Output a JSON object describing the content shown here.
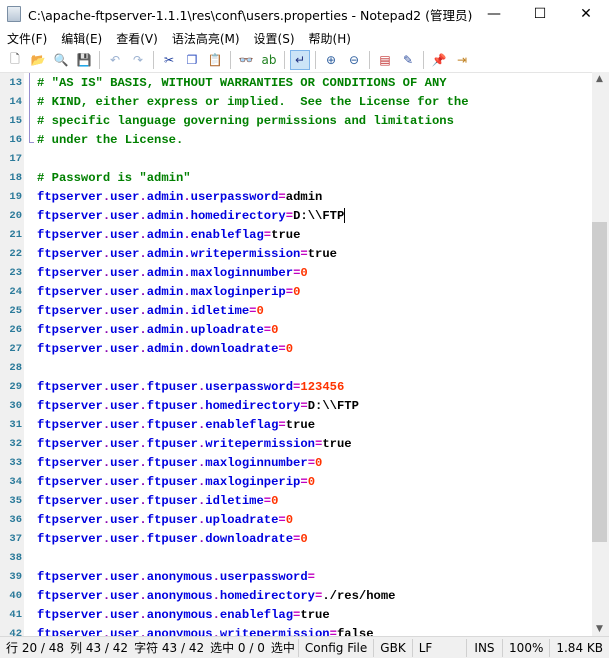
{
  "window": {
    "title": "C:\\apache-ftpserver-1.1.1\\res\\conf\\users.properties - Notepad2 (管理员)",
    "minimize": "—",
    "maximize": "☐",
    "close": "✕"
  },
  "menu": [
    "文件(F)",
    "编辑(E)",
    "查看(V)",
    "语法高亮(M)",
    "设置(S)",
    "帮助(H)"
  ],
  "toolbar": [
    {
      "icon": "new-file-icon",
      "glyph": "🗋",
      "color": "#555"
    },
    {
      "icon": "open-folder-icon",
      "glyph": "📂",
      "color": "#d9a020"
    },
    {
      "icon": "browse-icon",
      "glyph": "🔍",
      "color": "#c9a040"
    },
    {
      "icon": "save-icon",
      "glyph": "💾",
      "color": "#9aa0b8",
      "sep": true
    },
    {
      "icon": "undo-icon",
      "glyph": "↶",
      "color": "#9ab0d0"
    },
    {
      "icon": "redo-icon",
      "glyph": "↷",
      "color": "#9ab0d0",
      "sep": true
    },
    {
      "icon": "cut-icon",
      "glyph": "✂",
      "color": "#2040a0"
    },
    {
      "icon": "copy-icon",
      "glyph": "❐",
      "color": "#3050c0"
    },
    {
      "icon": "paste-icon",
      "glyph": "📋",
      "color": "#b08020",
      "sep": true
    },
    {
      "icon": "find-icon",
      "glyph": "👓",
      "color": "#203060"
    },
    {
      "icon": "replace-icon",
      "glyph": "ab",
      "color": "#208020",
      "sep": true
    },
    {
      "icon": "word-wrap-icon",
      "glyph": "↵",
      "color": "#203080",
      "active": true,
      "sep": true
    },
    {
      "icon": "zoom-in-icon",
      "glyph": "⊕",
      "color": "#3060a0"
    },
    {
      "icon": "zoom-out-icon",
      "glyph": "⊖",
      "color": "#3060a0",
      "sep": true
    },
    {
      "icon": "scheme-icon",
      "glyph": "▤",
      "color": "#c03030"
    },
    {
      "icon": "customize-scheme-icon",
      "glyph": "✎",
      "color": "#3050a0",
      "sep": true
    },
    {
      "icon": "pin-icon",
      "glyph": "📌",
      "color": "#333"
    },
    {
      "icon": "exit-icon",
      "glyph": "⇥",
      "color": "#c08020"
    }
  ],
  "colors": {
    "comment": "#008000",
    "key": "#0000e0",
    "number": "#ff3300",
    "line_number": "#2b7a9a"
  },
  "lines": [
    {
      "n": "13",
      "comment": "# \"AS IS\" BASIS, WITHOUT WARRANTIES OR CONDITIONS OF ANY"
    },
    {
      "n": "14",
      "comment": "# KIND, either express or implied.  See the License for the"
    },
    {
      "n": "15",
      "comment": "# specific language governing permissions and limitations"
    },
    {
      "n": "16",
      "comment": "# under the License."
    },
    {
      "n": "17"
    },
    {
      "n": "18",
      "comment": "# Password is \"admin\""
    },
    {
      "n": "19",
      "key": "ftpserver.user.admin.userpassword",
      "value": "admin"
    },
    {
      "n": "20",
      "key": "ftpserver.user.admin.homedirectory",
      "value": "D:\\\\FTP",
      "caret": true
    },
    {
      "n": "21",
      "key": "ftpserver.user.admin.enableflag",
      "value": "true"
    },
    {
      "n": "22",
      "key": "ftpserver.user.admin.writepermission",
      "value": "true"
    },
    {
      "n": "23",
      "key": "ftpserver.user.admin.maxloginnumber",
      "value": "0",
      "num": true
    },
    {
      "n": "24",
      "key": "ftpserver.user.admin.maxloginperip",
      "value": "0",
      "num": true
    },
    {
      "n": "25",
      "key": "ftpserver.user.admin.idletime",
      "value": "0",
      "num": true
    },
    {
      "n": "26",
      "key": "ftpserver.user.admin.uploadrate",
      "value": "0",
      "num": true
    },
    {
      "n": "27",
      "key": "ftpserver.user.admin.downloadrate",
      "value": "0",
      "num": true
    },
    {
      "n": "28"
    },
    {
      "n": "29",
      "key": "ftpserver.user.ftpuser.userpassword",
      "value": "123456",
      "num": true
    },
    {
      "n": "30",
      "key": "ftpserver.user.ftpuser.homedirectory",
      "value": "D:\\\\FTP"
    },
    {
      "n": "31",
      "key": "ftpserver.user.ftpuser.enableflag",
      "value": "true"
    },
    {
      "n": "32",
      "key": "ftpserver.user.ftpuser.writepermission",
      "value": "true"
    },
    {
      "n": "33",
      "key": "ftpserver.user.ftpuser.maxloginnumber",
      "value": "0",
      "num": true
    },
    {
      "n": "34",
      "key": "ftpserver.user.ftpuser.maxloginperip",
      "value": "0",
      "num": true
    },
    {
      "n": "35",
      "key": "ftpserver.user.ftpuser.idletime",
      "value": "0",
      "num": true
    },
    {
      "n": "36",
      "key": "ftpserver.user.ftpuser.uploadrate",
      "value": "0",
      "num": true
    },
    {
      "n": "37",
      "key": "ftpserver.user.ftpuser.downloadrate",
      "value": "0",
      "num": true
    },
    {
      "n": "38"
    },
    {
      "n": "39",
      "key": "ftpserver.user.anonymous.userpassword",
      "value": ""
    },
    {
      "n": "40",
      "key": "ftpserver.user.anonymous.homedirectory",
      "value": "./res/home"
    },
    {
      "n": "41",
      "key": "ftpserver.user.anonymous.enableflag",
      "value": "true"
    },
    {
      "n": "42",
      "key": "ftpserver.user.anonymous.writepermission",
      "value": "false"
    }
  ],
  "status": {
    "line": "行 20 / 48",
    "col": "列 43 / 42",
    "char": "字符 43 / 42",
    "sel": "选中 0 / 0",
    "sel2": "选中",
    "scheme": "Config File",
    "encoding": "GBK",
    "eol": "LF",
    "mode": "INS",
    "zoom": "100%",
    "size": "1.84 KB"
  }
}
